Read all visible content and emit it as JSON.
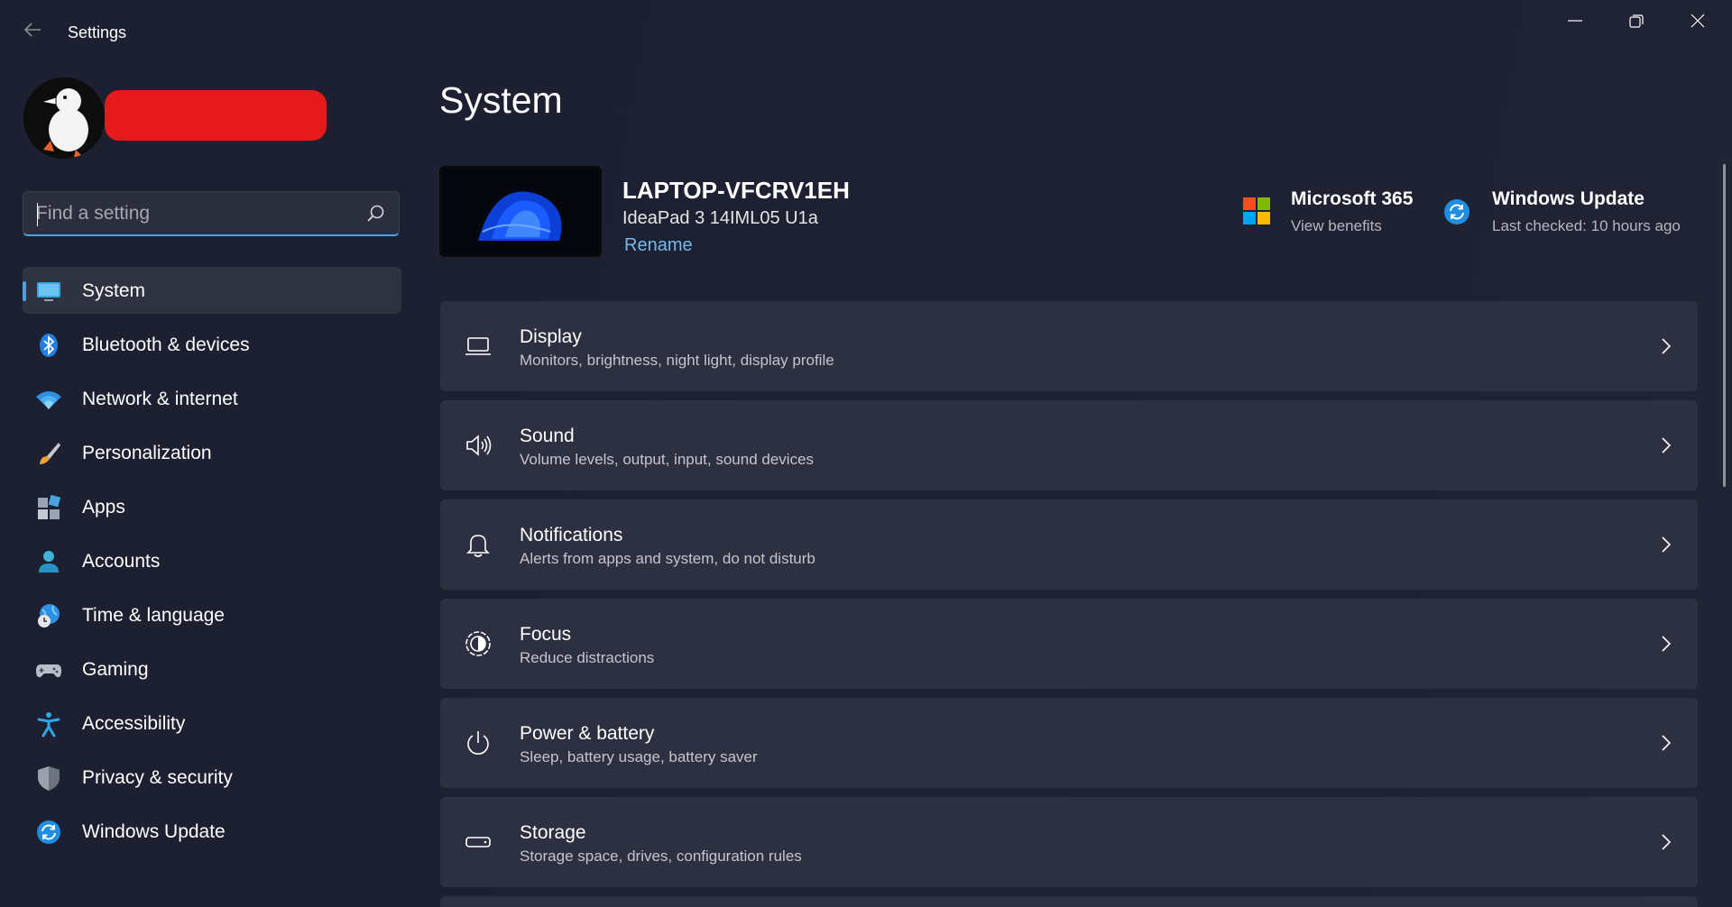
{
  "window": {
    "title": "Settings"
  },
  "search": {
    "placeholder": "Find a setting",
    "value": ""
  },
  "sidebar": {
    "items": [
      {
        "label": "System",
        "icon": "monitor-icon",
        "active": true
      },
      {
        "label": "Bluetooth & devices",
        "icon": "bluetooth-icon"
      },
      {
        "label": "Network & internet",
        "icon": "wifi-icon"
      },
      {
        "label": "Personalization",
        "icon": "paintbrush-icon"
      },
      {
        "label": "Apps",
        "icon": "apps-icon"
      },
      {
        "label": "Accounts",
        "icon": "person-icon"
      },
      {
        "label": "Time & language",
        "icon": "globe-clock-icon"
      },
      {
        "label": "Gaming",
        "icon": "gamepad-icon"
      },
      {
        "label": "Accessibility",
        "icon": "accessibility-icon"
      },
      {
        "label": "Privacy & security",
        "icon": "shield-icon"
      },
      {
        "label": "Windows Update",
        "icon": "refresh-icon"
      }
    ]
  },
  "main": {
    "title": "System",
    "device": {
      "name": "LAPTOP-VFCRV1EH",
      "model": "IdeaPad 3 14IML05 U1a",
      "rename_label": "Rename"
    },
    "quick_links": [
      {
        "title": "Microsoft 365",
        "subtitle": "View benefits",
        "icon": "microsoft-logo-icon"
      },
      {
        "title": "Windows Update",
        "subtitle": "Last checked: 10 hours ago",
        "icon": "windows-update-icon"
      }
    ],
    "cards": [
      {
        "title": "Display",
        "desc": "Monitors, brightness, night light, display profile",
        "icon": "laptop-icon"
      },
      {
        "title": "Sound",
        "desc": "Volume levels, output, input, sound devices",
        "icon": "speaker-icon"
      },
      {
        "title": "Notifications",
        "desc": "Alerts from apps and system, do not disturb",
        "icon": "bell-icon"
      },
      {
        "title": "Focus",
        "desc": "Reduce distractions",
        "icon": "focus-icon"
      },
      {
        "title": "Power & battery",
        "desc": "Sleep, battery usage, battery saver",
        "icon": "power-icon"
      },
      {
        "title": "Storage",
        "desc": "Storage space, drives, configuration rules",
        "icon": "storage-icon"
      }
    ]
  },
  "colors": {
    "accent": "#4aa3df",
    "background": "#1c2030",
    "card": "#323646",
    "link": "#76b9ed"
  }
}
